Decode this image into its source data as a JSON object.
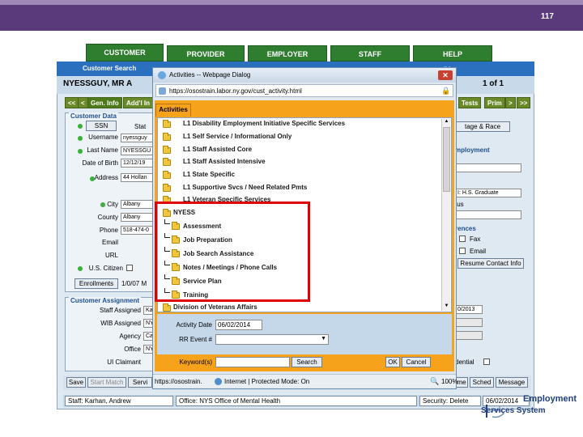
{
  "slide": {
    "number": "117"
  },
  "main_tabs": [
    "CUSTOMER",
    "PROVIDER",
    "EMPLOYER",
    "STAFF",
    "HELP"
  ],
  "nav2": {
    "customer_search": "Customer Search",
    "other": "...",
    "right": "ne"
  },
  "customer": {
    "name": "NYESSGUY, MR A",
    "page_count": "1 of 1"
  },
  "sub_tabs": [
    "<<",
    "<",
    "Gen. Info",
    "Add'l In",
    "Tests",
    "Prim",
    ">",
    ">>"
  ],
  "customer_data": {
    "title": "Customer Data",
    "ssn_button": "SSN",
    "stat": "Stat",
    "username_label": "Username",
    "username_value": "nyessguy",
    "lastname_label": "Last Name",
    "lastname_value": "NYESSGU",
    "dob_label": "Date of Birth",
    "dob_value": "12/12/19",
    "address_label": "Address",
    "address_value": "44 Hollan",
    "city_label": "City",
    "city_value": "Albany",
    "county_label": "County",
    "county_value": "Albany",
    "phone_label": "Phone",
    "phone_value": "518-474-0",
    "email_label": "Email",
    "url_label": "URL",
    "citizen_label": "U.S. Citizen",
    "enrollments_button": "Enrollments",
    "enroll_value": "1/0/07 M"
  },
  "right_panel": {
    "race_button": "tage & Race",
    "employment_title": "mployment",
    "grad_value": "I: H.S. Graduate",
    "status_label": "tus",
    "prefs_title": "rences",
    "fax_label": "Fax",
    "email_label": "Email",
    "resume_button": "Resume Contact Info",
    "date_value": "0/2013",
    "confidential_label": "dential"
  },
  "assignment": {
    "title": "Customer Assignment",
    "staff_label": "Staff Assigned",
    "staff_value": "Ka",
    "wib_label": "WIB Assigned",
    "wib_value": "NY",
    "agency_label": "Agency",
    "agency_value": "Ca",
    "office_label": "Office",
    "office_value": "NY",
    "ui_label": "UI Claimant"
  },
  "bottom_buttons": [
    "Save",
    "Start Match",
    "Servi",
    "me",
    "Sched",
    "Message"
  ],
  "status": {
    "staff": "Staff: Karhan, Andrew",
    "office": "Office: NYS Office of Mental Health",
    "security": "Security: Delete",
    "date": "06/02/2014"
  },
  "dialog": {
    "title": "Activities -- Webpage Dialog",
    "url": "https://osostrain.labor.ny.gov/cust_activity.html",
    "activities_tab": "Activities",
    "tree_items": [
      "L1 Disability Employment Initiative Specific Services",
      "L1 Self Service / Informational Only",
      "L1 Staff Assisted Core",
      "L1 Staff Assisted Intensive",
      "L1 State Specific",
      "L1 Supportive Svcs / Need Related Pmts",
      "L1 Veteran Specific Services",
      "NYESS",
      "Assessment",
      "Job Preparation",
      "Job Search Assistance",
      "Notes / Meetings / Phone Calls",
      "Service Plan",
      "Training",
      "Division of Veterans Affairs"
    ],
    "activity_date_label": "Activity Date",
    "activity_date_value": "06/02/2014",
    "rr_event_label": "RR Event #",
    "keyword_label": "Keyword(s)",
    "search_button": "Search",
    "ok_button": "OK",
    "cancel_button": "Cancel",
    "status_url": "https://osostrain.",
    "status_zone": "Internet | Protected Mode: On",
    "zoom": "100%"
  },
  "logo": {
    "line1": "Employment",
    "line2": "Services System"
  },
  "colors": {
    "slide_bar": "#5a3a7a",
    "tab_green": "#2f7d2f",
    "dialog_orange": "#f6a21a",
    "highlight": "#e00000"
  }
}
